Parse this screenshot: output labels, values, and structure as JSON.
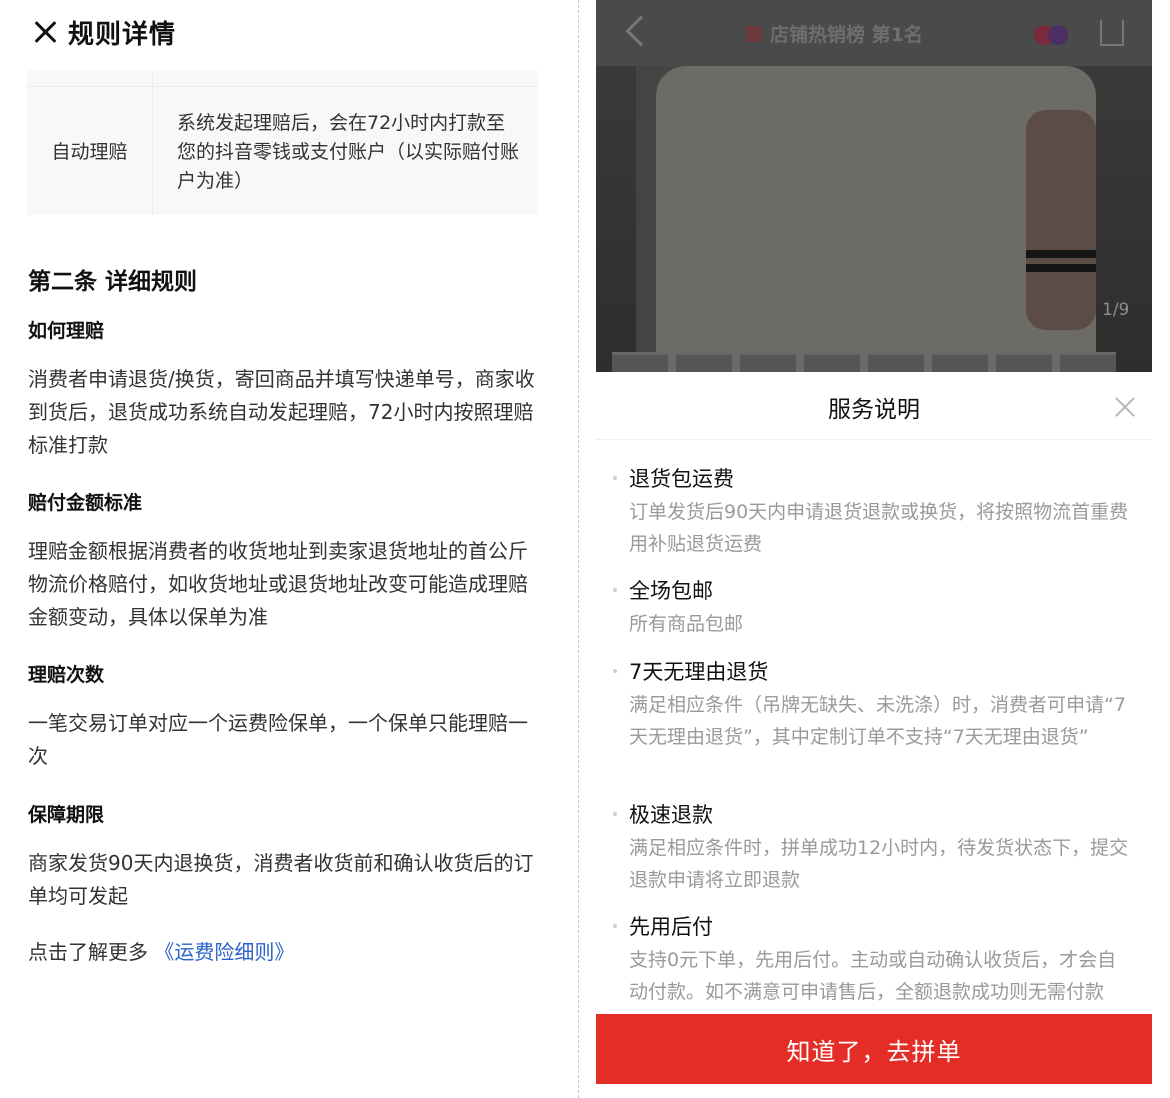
{
  "left": {
    "header_title": "规则详情",
    "table": {
      "label": "自动理赔",
      "text": "系统发起理赔后，会在72小时内打款至您的抖音零钱或支付账户（以实际赔付账户为准）"
    },
    "section_title": "第二条 详细规则",
    "sections": [
      {
        "title": "如何理赔",
        "text": "消费者申请退货/换货，寄回商品并填写快递单号，商家收到货后，退货成功系统自动发起理赔，72小时内按照理赔标准打款"
      },
      {
        "title": "赔付金额标准",
        "text": "理赔金额根据消费者的收货地址到卖家退货地址的首公斤物流价格赔付，如收货地址或退货地址改变可能造成理赔金额变动，具体以保单为准"
      },
      {
        "title": "理赔次数",
        "text": "一笔交易订单对应一个运费险保单，一个保单只能理赔一次"
      },
      {
        "title": "保障期限",
        "text": "商家发货90天内退换货，消费者收货前和确认收货后的订单均可发起"
      }
    ],
    "more_prefix": "点击了解更多",
    "more_link": "《运费险细则》"
  },
  "right": {
    "rank_text": "店铺热销榜 第1名",
    "image_counter": "1/9",
    "sheet_title": "服务说明",
    "services": [
      {
        "name": "退货包运费",
        "desc": "订单发货后90天内申请退货退款或换货，将按照物流首重费用补贴退货运费"
      },
      {
        "name": "全场包邮",
        "desc": "所有商品包邮"
      },
      {
        "name": "7天无理由退货",
        "desc": "满足相应条件（吊牌无缺失、未洗涤）时，消费者可申请“7天无理由退货”，其中定制订单不支持“7天无理由退货”"
      },
      {
        "name": "极速退款",
        "desc": "满足相应条件时，拼单成功12小时内，待发货状态下，提交退款申请将立即退款"
      },
      {
        "name": "先用后付",
        "desc": "支持0元下单，先用后付。主动或自动确认收货后，才会自动付款。如不满意可申请售后，全额退款成功则无需付款"
      }
    ],
    "cta_label": "知道了，去拼单",
    "colors": {
      "cta": "#e52d27",
      "link": "#2a62c9"
    }
  }
}
